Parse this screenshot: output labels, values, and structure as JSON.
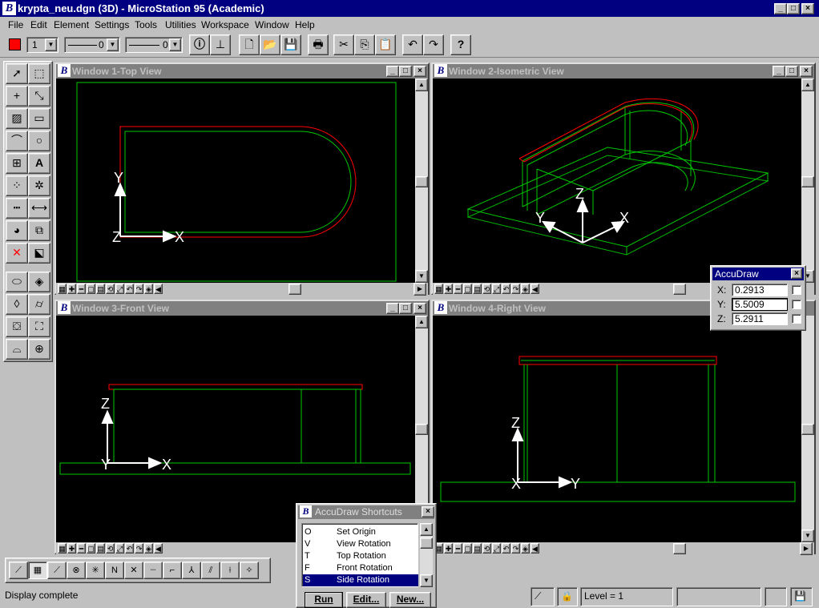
{
  "app": {
    "title": "krypta_neu.dgn (3D) - MicroStation 95 (Academic)",
    "logo": "B",
    "minimize": "_",
    "maximize": "□",
    "close": "×"
  },
  "menu": [
    "File",
    "Edit",
    "Element",
    "Settings",
    "Tools",
    "Utilities",
    "Workspace",
    "Window",
    "Help"
  ],
  "toolbar": {
    "active_color": "#ff0000",
    "level_value": "1",
    "style_value": "0",
    "weight_value": "0"
  },
  "views": [
    {
      "title": "Window 1-Top View"
    },
    {
      "title": "Window 2-Isometric View"
    },
    {
      "title": "Window 3-Front View"
    },
    {
      "title": "Window 4-Right View"
    }
  ],
  "axes": {
    "x": "X",
    "y": "Y",
    "z": "Z"
  },
  "accudraw": {
    "title": "AccuDraw",
    "x_label": "X:",
    "x_value": "0.2913",
    "y_label": "Y:",
    "y_value": "5.5009",
    "z_label": "Z:",
    "z_value": "5.2911"
  },
  "shortcuts": {
    "title": "AccuDraw Shortcuts",
    "items": [
      {
        "key": "O",
        "name": "Set Origin"
      },
      {
        "key": "V",
        "name": "View Rotation"
      },
      {
        "key": "T",
        "name": "Top Rotation"
      },
      {
        "key": "F",
        "name": "Front Rotation"
      },
      {
        "key": "S",
        "name": "Side Rotation"
      }
    ],
    "run": "Run",
    "edit": "Edit...",
    "new": "New..."
  },
  "status": {
    "message": "Display complete",
    "level": "Level = 1"
  },
  "colors": {
    "red_line": "#ff0000",
    "green_line": "#00c800",
    "title_active": "#000080",
    "title_inactive": "#808080"
  }
}
